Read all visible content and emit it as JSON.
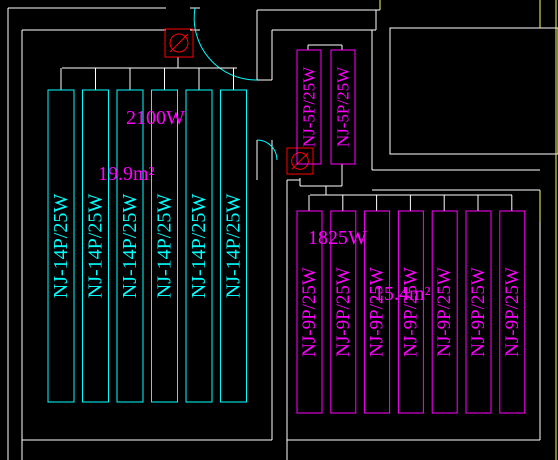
{
  "colors": {
    "background": "#000000",
    "wall": "#FFFFFF",
    "wall_outer": "#FFFF66",
    "fixture_left": "#00FFFF",
    "fixture_right": "#FF00FF",
    "label": "#FF00FF",
    "wiring": "#FFFFFF",
    "symbol_stroke": "#FF0000",
    "door_arc": "#00FFFF"
  },
  "room_left": {
    "power": "2100W",
    "area": "19.9m²"
  },
  "room_right": {
    "power": "1825W",
    "area": "15.4m²"
  },
  "fixtures_left": [
    {
      "label": "NJ-14P/25W"
    },
    {
      "label": "NJ-14P/25W"
    },
    {
      "label": "NJ-14P/25W"
    },
    {
      "label": "NJ-14P/25W"
    },
    {
      "label": "NJ-14P/25W"
    },
    {
      "label": "NJ-14P/25W"
    }
  ],
  "fixtures_corridor": [
    {
      "label": "NJ-5P/25W"
    },
    {
      "label": "NJ-5P/25W"
    }
  ],
  "fixtures_right": [
    {
      "label": "NJ-9P/25W"
    },
    {
      "label": "NJ-9P/25W"
    },
    {
      "label": "NJ-9P/25W"
    },
    {
      "label": "NJ-9P/25W"
    },
    {
      "label": "NJ-9P/25W"
    },
    {
      "label": "NJ-9P/25W"
    },
    {
      "label": "NJ-9P/25W"
    }
  ],
  "symbols": [
    {
      "name": "circle-slash-icon"
    },
    {
      "name": "circle-slash-icon"
    }
  ]
}
